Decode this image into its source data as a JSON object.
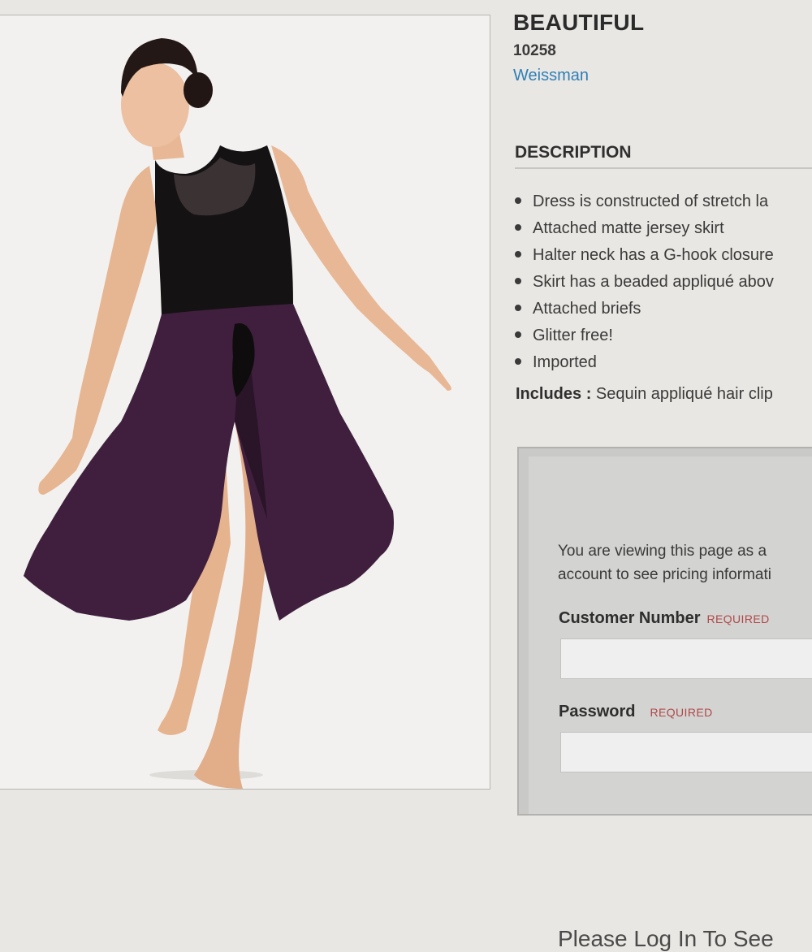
{
  "product": {
    "title": "BEAUTIFUL",
    "sku": "10258",
    "brand": "Weissman"
  },
  "image": {
    "subject": "dancer-in-lace-leotard-and-plum-skirt"
  },
  "description": {
    "heading": "DESCRIPTION",
    "items": [
      "Dress is constructed of stretch la",
      "Attached matte jersey skirt",
      "Halter neck has a G-hook closure",
      "Skirt has a beaded appliqué abov",
      "Attached briefs",
      "Glitter free!",
      "Imported"
    ],
    "includes_label": "Includes :",
    "includes_value": " Sequin appliqué hair clip"
  },
  "login": {
    "title": "Please Log In To See",
    "text_line1": "You are viewing this page as a",
    "text_line2": "account to see pricing informati",
    "customer_number_label": "Customer Number",
    "password_label": "Password",
    "required_label": "REQUIRED",
    "customer_number_value": "",
    "password_value": ""
  },
  "colors": {
    "page_bg": "#e9e7e3",
    "brand_link": "#2f7fb8",
    "required": "#b04848",
    "skirt": "#3f1f3d",
    "login_panel": "#d3d3d1"
  }
}
